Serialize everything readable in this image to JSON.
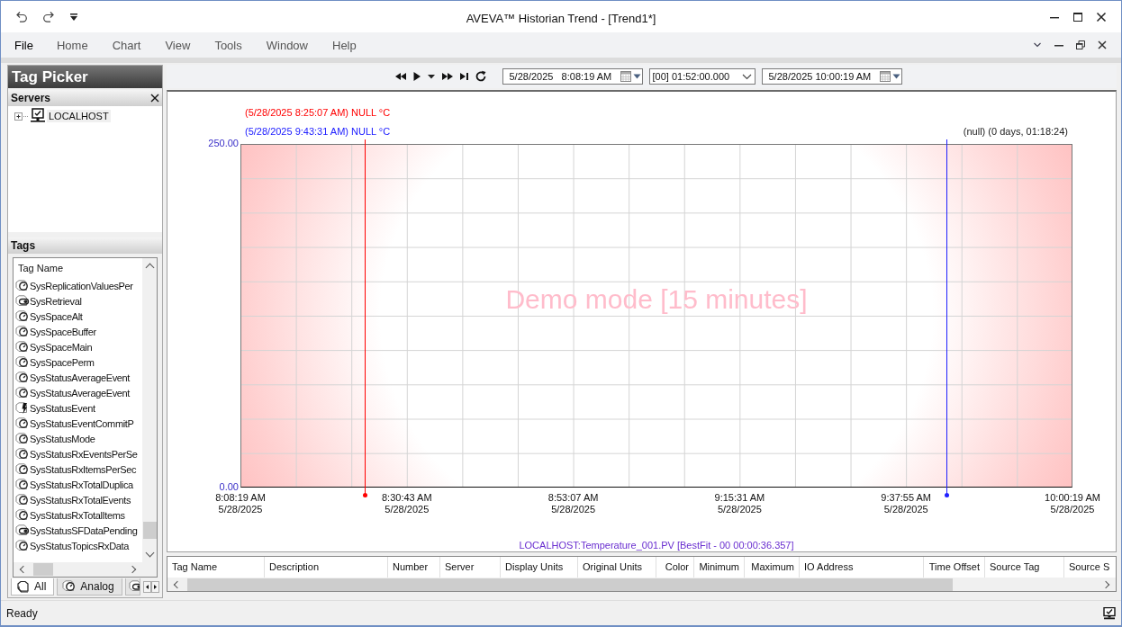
{
  "window": {
    "title": "AVEVA™ Historian Trend - [Trend1*]"
  },
  "menu": [
    {
      "label": "File",
      "selected": true
    },
    {
      "label": "Home",
      "selected": false
    },
    {
      "label": "Chart",
      "selected": false
    },
    {
      "label": "View",
      "selected": false
    },
    {
      "label": "Tools",
      "selected": false
    },
    {
      "label": "Window",
      "selected": false
    },
    {
      "label": "Help",
      "selected": false
    }
  ],
  "tag_picker": {
    "title": "Tag Picker",
    "servers": {
      "title": "Servers",
      "items": [
        {
          "label": "LOCALHOST",
          "expanded": false
        }
      ]
    },
    "tags": {
      "title": "Tags",
      "column": "Tag Name",
      "items": [
        {
          "name": "SysReplicationValuesPer",
          "kind": "analog"
        },
        {
          "name": "SysRetrieval",
          "kind": "discrete"
        },
        {
          "name": "SysSpaceAlt",
          "kind": "analog"
        },
        {
          "name": "SysSpaceBuffer",
          "kind": "analog"
        },
        {
          "name": "SysSpaceMain",
          "kind": "analog"
        },
        {
          "name": "SysSpacePerm",
          "kind": "analog"
        },
        {
          "name": "SysStatusAverageEvent",
          "kind": "analog"
        },
        {
          "name": "SysStatusAverageEvent",
          "kind": "analog"
        },
        {
          "name": "SysStatusEvent",
          "kind": "event"
        },
        {
          "name": "SysStatusEventCommitP",
          "kind": "analog"
        },
        {
          "name": "SysStatusMode",
          "kind": "analog"
        },
        {
          "name": "SysStatusRxEventsPerSe",
          "kind": "analog"
        },
        {
          "name": "SysStatusRxItemsPerSec",
          "kind": "analog"
        },
        {
          "name": "SysStatusRxTotalDuplica",
          "kind": "analog"
        },
        {
          "name": "SysStatusRxTotalEvents",
          "kind": "analog"
        },
        {
          "name": "SysStatusRxTotalItems",
          "kind": "analog"
        },
        {
          "name": "SysStatusSFDataPending",
          "kind": "discrete"
        },
        {
          "name": "SysStatusTopicsRxData",
          "kind": "analog"
        }
      ],
      "tabs": [
        {
          "label": "All",
          "kind": "all",
          "selected": true
        },
        {
          "label": "Analog",
          "kind": "analog",
          "selected": false
        },
        {
          "kind": "discrete",
          "selected": false
        }
      ]
    }
  },
  "toolbar": {
    "start_time": "5/28/2025   8:08:19 AM",
    "duration": "[00] 01:52:00.000",
    "end_time": "5/28/2025 10:00:19 AM"
  },
  "trend": {
    "cursors": [
      {
        "label": "(5/28/2025 8:25:07 AM) NULL °C",
        "color": "#ff0000",
        "level": 0.149
      },
      {
        "label": "(5/28/2025 9:43:31 AM) NULL °C",
        "color": "#2020ff",
        "level": 0.849
      }
    ],
    "cursor_span": "(null) (0 days, 01:18:24)",
    "y_labels": [
      "250.00",
      "0.00"
    ],
    "x_labels": [
      {
        "time": "8:08:19 AM",
        "date": "5/28/2025"
      },
      {
        "time": "8:30:43 AM",
        "date": "5/28/2025"
      },
      {
        "time": "8:53:07 AM",
        "date": "5/28/2025"
      },
      {
        "time": "9:15:31 AM",
        "date": "5/28/2025"
      },
      {
        "time": "9:37:55 AM",
        "date": "5/28/2025"
      },
      {
        "time": "10:00:19 AM",
        "date": "5/28/2025"
      }
    ],
    "watermark": "Demo mode [15 minutes]",
    "legend": "LOCALHOST:Temperature_001.PV [BestFit - 00 00:00:36.357]"
  },
  "tag_table": {
    "columns": [
      "Tag Name",
      "Description",
      "Number",
      "Server",
      "Display Units",
      "Original Units",
      "Color",
      "Minimum",
      "Maximum",
      "IO Address",
      "Time Offset",
      "Source Tag",
      "Source S"
    ]
  },
  "status_bar": {
    "text": "Ready"
  }
}
